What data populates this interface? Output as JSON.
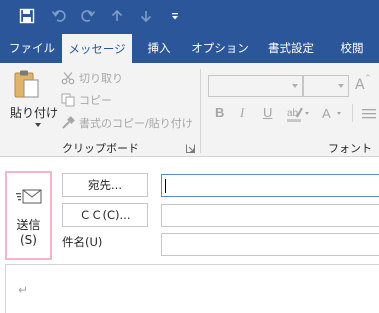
{
  "colors": {
    "ribbon_blue": "#2b579a",
    "ribbon_bg": "#f3f3f3",
    "disabled_text": "#a6a6a6",
    "send_highlight": "#f4b6c7"
  },
  "quick_access": [
    {
      "icon": "save-icon"
    },
    {
      "icon": "undo-icon"
    },
    {
      "icon": "redo-icon"
    },
    {
      "icon": "arrow-up-icon"
    },
    {
      "icon": "arrow-down-icon"
    },
    {
      "icon": "customize-toolbar-icon"
    }
  ],
  "tabs": [
    {
      "label": "ファイル",
      "active": false
    },
    {
      "label": "メッセージ",
      "active": true
    },
    {
      "label": "挿入",
      "active": false
    },
    {
      "label": "オプション",
      "active": false
    },
    {
      "label": "書式設定",
      "active": false
    },
    {
      "label": "校閲",
      "active": false
    }
  ],
  "clipboard": {
    "paste_label": "貼り付け",
    "cut_label": "切り取り",
    "copy_label": "コピー",
    "format_painter_label": "書式のコピー/貼り付け",
    "group_label": "クリップボード"
  },
  "font_group": {
    "group_label": "フォント",
    "bold": "B",
    "italic": "I",
    "underline": "U",
    "grow_font": "A"
  },
  "compose": {
    "send_label": "送信",
    "send_shortcut": "(S)",
    "to_button": "宛先...",
    "cc_button": "ＣＣ(C)...",
    "subject_label": "件名(U)",
    "to_value": "",
    "cc_value": "",
    "subject_value": "",
    "body_mark": "↵"
  }
}
